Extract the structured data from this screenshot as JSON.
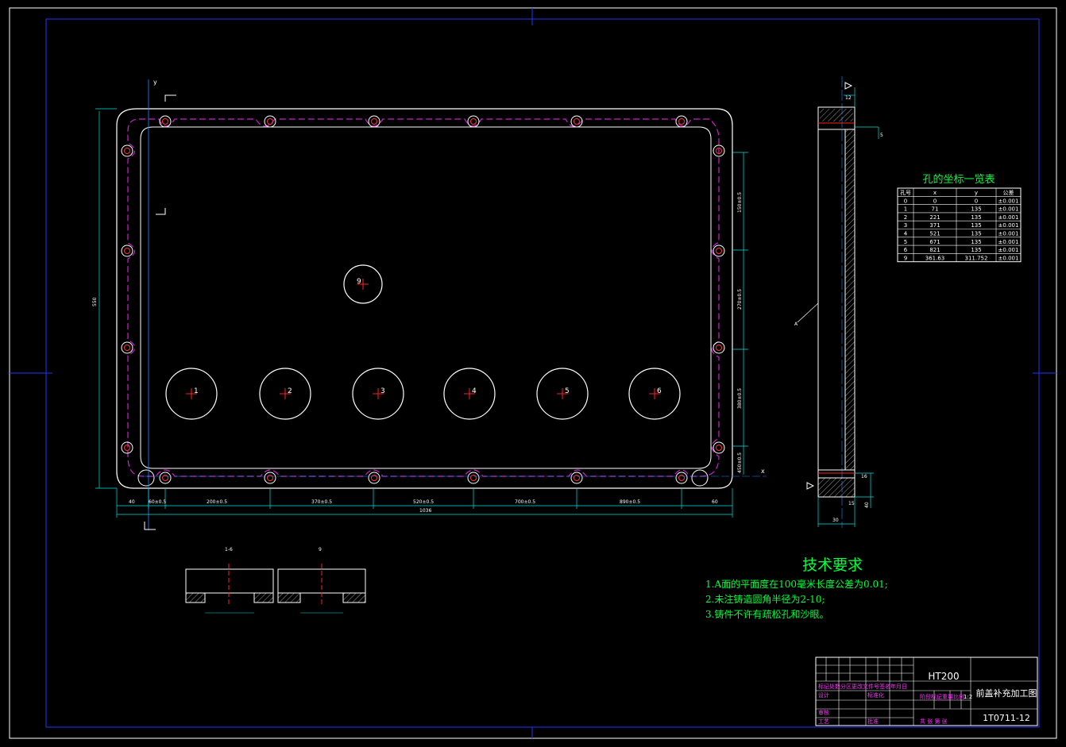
{
  "hole_table": {
    "title": "孔的坐标一览表",
    "headers": [
      "孔号",
      "x",
      "y",
      "公差"
    ],
    "rows": [
      [
        "0",
        "0",
        "0",
        "±0.001"
      ],
      [
        "1",
        "71",
        "135",
        "±0.001"
      ],
      [
        "2",
        "221",
        "135",
        "±0.001"
      ],
      [
        "3",
        "371",
        "135",
        "±0.001"
      ],
      [
        "4",
        "521",
        "135",
        "±0.001"
      ],
      [
        "5",
        "671",
        "135",
        "±0.001"
      ],
      [
        "6",
        "821",
        "135",
        "±0.001"
      ],
      [
        "9",
        "361.63",
        "311.752",
        "±0.001"
      ]
    ]
  },
  "tech_requirements": {
    "title": "技术要求",
    "items": [
      "1.A面的平面度在100毫米长度公差为0.01;",
      "2.未注铸造圆角半径为2-10;",
      "3.铸件不许有疏松孔和沙眼。"
    ]
  },
  "title_block": {
    "material": "HT200",
    "drawing_title": "前盖补充加工图",
    "drawing_number": "1T0711-12",
    "scale": "1:2",
    "revision_header": "标记处数分区更改文件号签名年月日",
    "stage_header": "阶段标记重量比例",
    "designer": "设计",
    "standardize": "标准化",
    "reviewer": "审核",
    "process": "工艺",
    "approve": "批准",
    "sheets": "共  张 第  张"
  },
  "plan_view": {
    "hole_labels": [
      "1",
      "2",
      "3",
      "4",
      "5",
      "6"
    ],
    "hole9_label": "9",
    "axis_x": "x",
    "axis_y": "y",
    "bottom_dims": [
      "40",
      "60±0.5",
      "200±0.5",
      "370±0.5",
      "520±0.5",
      "700±0.5",
      "890±0.5",
      "60"
    ],
    "overall_width": "1036",
    "overall_height": "550",
    "right_dims": [
      "150±0.5",
      "270±0.5",
      "380±0.5",
      "450±0.5"
    ]
  },
  "section_view": {
    "label_a": "A",
    "dims": [
      "12",
      "30",
      "15",
      "40",
      "16",
      "5"
    ]
  },
  "detail_views": {
    "left_label": "1-6",
    "right_label": "9"
  }
}
